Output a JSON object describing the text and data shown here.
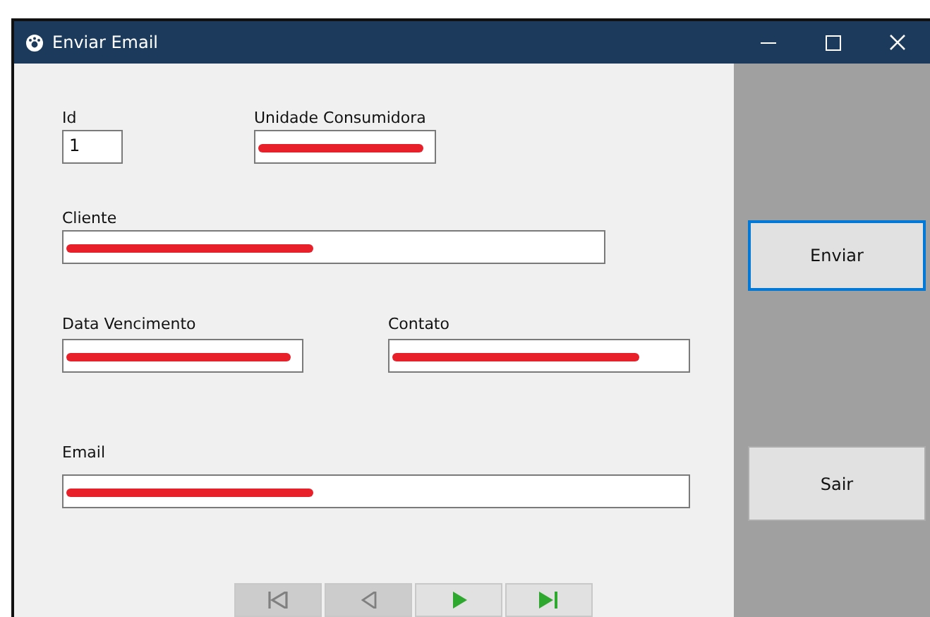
{
  "window": {
    "title": "Enviar Email"
  },
  "rows": [
    {
      "fields": [
        {
          "label": "Id",
          "value": "1",
          "redacted": false
        },
        {
          "label": "Unidade Consumidora",
          "redacted": true
        }
      ]
    },
    {
      "fields": [
        {
          "label": "Cliente",
          "redacted": true
        }
      ]
    },
    {
      "fields": [
        {
          "label": "Data Vencimento",
          "redacted": true
        },
        {
          "label": "Contato",
          "redacted": true
        }
      ]
    },
    {
      "fields": [
        {
          "label": "Email",
          "redacted": true
        }
      ]
    }
  ],
  "navigator": [
    {
      "kind": "first",
      "disabled": true
    },
    {
      "kind": "previous",
      "disabled": true
    },
    {
      "kind": "next",
      "disabled": false
    },
    {
      "kind": "last",
      "disabled": false
    }
  ],
  "buttons": [
    {
      "label": "Enviar",
      "selected": true
    },
    {
      "label": "Sair",
      "selected": false
    }
  ]
}
